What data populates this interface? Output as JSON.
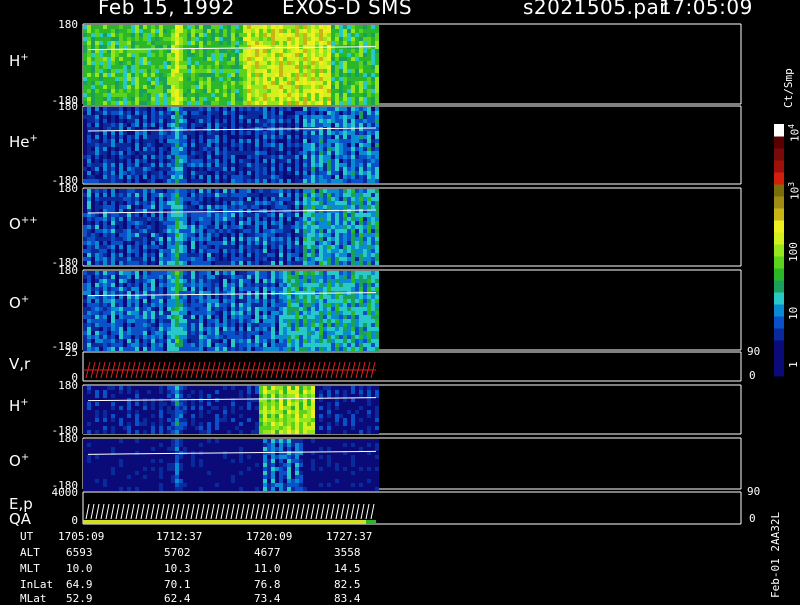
{
  "header": {
    "date": "Feb 15, 1992",
    "instrument": "EXOS-D SMS",
    "file": "s2021505.par",
    "time": "17:05:09"
  },
  "panels": [
    {
      "label": "H",
      "sup": "+",
      "top_tick": "180",
      "bottom_tick": "-180"
    },
    {
      "label": "He",
      "sup": "+",
      "top_tick": "180",
      "bottom_tick": "-180"
    },
    {
      "label": "O",
      "sup": "++",
      "top_tick": "180",
      "bottom_tick": "-180"
    },
    {
      "label": "O",
      "sup": "+",
      "top_tick": "180",
      "bottom_tick": "-180"
    },
    {
      "label": "V,r",
      "sup": "",
      "top_tick": "25",
      "bottom_tick": "0",
      "right_top": "90",
      "right_bottom": "0"
    },
    {
      "label": "H",
      "sup": "+",
      "top_tick": "180",
      "bottom_tick": "-180"
    },
    {
      "label": "O",
      "sup": "+",
      "top_tick": "180",
      "bottom_tick": "-180"
    },
    {
      "label": "E,p",
      "sup": "",
      "label2": "QA",
      "top_tick": "4000",
      "bottom_tick": "0",
      "right_top": "90",
      "right_bottom": "0"
    }
  ],
  "colorbar": {
    "unit": "Ct/Smp",
    "ticks": [
      {
        "text": "1",
        "sup": ""
      },
      {
        "text": "10",
        "sup": ""
      },
      {
        "text": "100",
        "sup": ""
      },
      {
        "text": "10",
        "sup": "3"
      },
      {
        "text": "10",
        "sup": "4"
      }
    ],
    "colors": [
      "#0a0a78",
      "#0a0a78",
      "#0a0a78",
      "#0a2a9c",
      "#0a50c8",
      "#0a8ad2",
      "#28c8c8",
      "#1aa05a",
      "#2ab82a",
      "#5ad21e",
      "#96e61e",
      "#d2f01e",
      "#f0f01e",
      "#c8b414",
      "#a08c14",
      "#7a6e0a",
      "#d21e0a",
      "#a0100a",
      "#780a0a",
      "#5a0000",
      "#ffffff"
    ]
  },
  "ephemeris": {
    "labels": [
      "UT",
      "ALT",
      "MLT",
      "InLat",
      "MLat"
    ],
    "columns": [
      [
        "1705:09",
        "6593",
        "10.0",
        "64.9",
        "52.9"
      ],
      [
        "1712:37",
        "5702",
        "10.3",
        "70.1",
        "62.4"
      ],
      [
        "1720:09",
        "4677",
        "11.0",
        "76.8",
        "73.4"
      ],
      [
        "1727:37",
        "3558",
        "14.5",
        "82.5",
        "83.4"
      ]
    ]
  },
  "footer": "Feb-01 2AA32L"
}
